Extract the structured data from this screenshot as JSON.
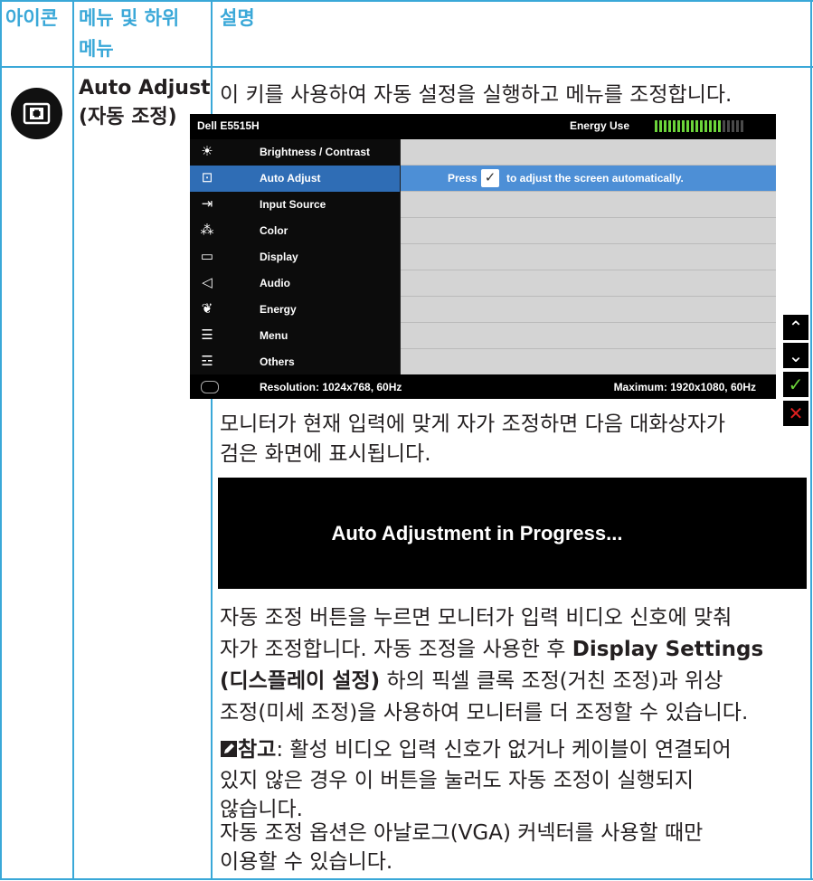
{
  "header": {
    "icon_col": "아이콘",
    "menu_col_line1": "메뉴 및 하위",
    "menu_col_line2": "메뉴",
    "desc_col": "설명"
  },
  "row": {
    "icon_name": "auto-adjust-icon",
    "menu_name_line1": "Auto Adjust",
    "menu_name_line2": "(자동 조정)",
    "intro": "이 키를 사용하여 자동 설정을 실행하고 메뉴를 조정합니다.",
    "para1_line1": "모니터가 현재 입력에 맞게 자가 조정하면 다음 대화상자가",
    "para1_line2": "검은 화면에 표시됩니다.",
    "progress_text": "Auto Adjustment in Progress...",
    "para2_line1": "자동 조정 버튼을 누르면 모니터가 입력 비디오 신호에 맞춰",
    "para2_line2_pre": "자가 조정합니다. 자동 조정을 사용한 후 ",
    "para2_line2_bold": "Display Settings",
    "para2_line3_bold": "(디스플레이 설정)",
    "para2_line3_post": " 하의 픽셀 클록 조정(거친 조정)과 위상",
    "para2_line4": "조정(미세 조정)을 사용하여 모니터를 더 조정할 수 있습니다.",
    "note_label": "참고",
    "note_line1": ": 활성 비디오 입력 신호가 없거나 케이블이 연결되어",
    "note_line2": "있지 않은 경우 이 버튼을 눌러도 자동 조정이 실행되지",
    "note_line3": "않습니다.",
    "para3_line1": "자동 조정 옵션은 아날로그(VGA) 커넥터를 사용할 때만",
    "para3_line2": "이용할 수 있습니다."
  },
  "osd": {
    "model": "Dell E5515H",
    "energy_label": "Energy Use",
    "energy_level_segments_on": 15,
    "energy_level_segments_total": 20,
    "menu_items": [
      {
        "label": "Brightness / Contrast",
        "icon": "brightness-icon",
        "glyph": "☀"
      },
      {
        "label": "Auto Adjust",
        "icon": "auto-adjust-icon",
        "glyph": "⊡"
      },
      {
        "label": "Input Source",
        "icon": "input-source-icon",
        "glyph": "⇥"
      },
      {
        "label": "Color",
        "icon": "color-icon",
        "glyph": "⁂"
      },
      {
        "label": "Display",
        "icon": "display-icon",
        "glyph": "▭"
      },
      {
        "label": "Audio",
        "icon": "audio-icon",
        "glyph": "◁"
      },
      {
        "label": "Energy",
        "icon": "energy-icon",
        "glyph": "❦"
      },
      {
        "label": "Menu",
        "icon": "menu-icon",
        "glyph": "☰"
      },
      {
        "label": "Others",
        "icon": "others-icon",
        "glyph": "☲"
      }
    ],
    "active_index": 1,
    "press_word": "Press",
    "press_rest": "to adjust the screen automatically.",
    "check_glyph": "✓",
    "resolution": "Resolution: 1024x768, 60Hz",
    "maximum": "Maximum: 1920x1080, 60Hz"
  },
  "nav_buttons": [
    {
      "name": "up-arrow-button",
      "glyph": "⌃",
      "color": "#ffffff"
    },
    {
      "name": "down-arrow-button",
      "glyph": "⌄",
      "color": "#ffffff"
    },
    {
      "name": "check-button",
      "glyph": "✓",
      "color": "#6cd43a"
    },
    {
      "name": "close-button",
      "glyph": "✕",
      "color": "#e02020"
    }
  ],
  "colors": {
    "border": "#3aa8d8",
    "header_text": "#3aa8d8",
    "active_menu": "#2f6db5",
    "energy_on": "#6cd43a"
  }
}
